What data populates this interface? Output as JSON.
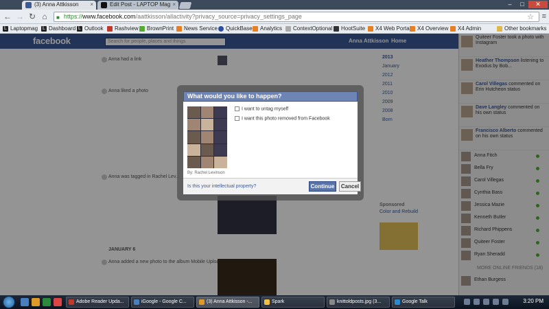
{
  "browser": {
    "tabs": [
      {
        "label": "(3) Anna Attkisson",
        "active": true
      },
      {
        "label": "Edit Post - LAPTOP Mag",
        "active": false
      }
    ],
    "url": {
      "scheme": "https://",
      "host": "www.facebook.com",
      "path": "/aattkisson/allactivity?privacy_source=privacy_settings_page"
    },
    "bookmarks": [
      "Laptopmag",
      "Dashboard",
      "Outlook",
      "Rashview",
      "BrownPrint",
      "News Service",
      "QuickBase",
      "Analytics",
      "ContextOptional",
      "HootSuite",
      "X4 Web Portal",
      "X4 Overview",
      "X4 Admin",
      "Other bookmarks"
    ]
  },
  "facebook": {
    "logo": "facebook",
    "search_placeholder": "Search for people, places and things",
    "nav": {
      "user": "Anna Attkisson",
      "home": "Home"
    },
    "feed": [
      {
        "text": "Anna had a link"
      },
      {
        "text": "Anna liked a photo"
      },
      {
        "text": "Anna was tagged in Rachel Lev..."
      },
      {
        "text": "JANUARY 6"
      },
      {
        "text": "Anna added a new photo to the album Mobile Uploads"
      }
    ],
    "timeline": [
      "2013",
      "January",
      "2012",
      "2011",
      "2010",
      "2009",
      "2008",
      "Born"
    ],
    "sponsored": {
      "heading": "Sponsored",
      "title": "Color and Rebuild"
    }
  },
  "sidebar": {
    "ticker": [
      {
        "name": "Qi",
        "text": "Quiteer Foster took a photo with Instagram"
      },
      {
        "name": "Heather Thompson",
        "text": "listening to Exodus by Bob..."
      },
      {
        "name": "Carol Villegas",
        "text": "commented on Erin Hutcheon status"
      },
      {
        "name": "Dave Langley",
        "text": "commented on his own status"
      },
      {
        "name": "Francisco Alberto",
        "text": "commented on his own status"
      }
    ],
    "chat": [
      "Anna Fitch",
      "Bella Fry",
      "Carol Villegas",
      "Cynthia Bass",
      "Jessica Mazie",
      "Kenneth Butler",
      "Richard Phippens",
      "Quiteer Foster",
      "Ryan Sheradd"
    ],
    "more_online": "MORE ONLINE FRIENDS (18)",
    "last_chat": "Ethan Burgess"
  },
  "dialog": {
    "title": "What would you like to happen?",
    "options": [
      "I want to untag myself",
      "I want this photo removed from Facebook"
    ],
    "byline": "By: Rachel Levinson",
    "ip_link": "Is this your intellectual property?",
    "continue_label": "Continue",
    "cancel_label": "Cancel"
  },
  "taskbar": {
    "tasks": [
      "Adobe Reader Upda...",
      "iGoogle - Google C...",
      "(3) Anna Attkisson -...",
      "Spark",
      "knittoldposts.jpg (3...",
      "Google Talk"
    ],
    "clock": "3:20 PM"
  }
}
